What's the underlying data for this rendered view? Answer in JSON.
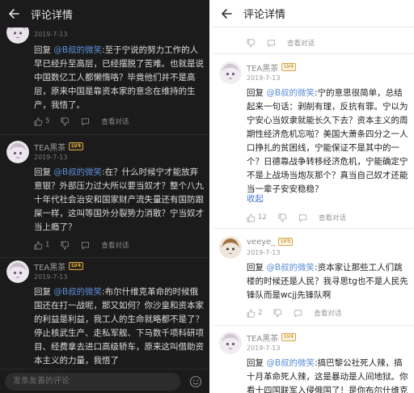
{
  "left": {
    "title": "评论详情",
    "input_placeholder": "发条友善的评论",
    "comments": [
      {
        "username": "",
        "date": "2019-7-13",
        "reply_prefix": "回复 ",
        "mention": "@B叔的微笑",
        "text": ":至于宁说的努力工作的人早已经升至高层，已经摆脱了苦难。也就是说中国数亿工人都懒惰咯？毕竟他们并不是高层，原来中国是靠资本家的意念在维持的生产，我悟了。",
        "likes": "5",
        "view_label": "查看对话"
      },
      {
        "username": "TEA黑茶",
        "level": "LV4",
        "date": "2019-7-13",
        "reply_prefix": "回复 ",
        "mention": "@B叔的微笑",
        "text": ":在？什么时候宁才能放弃意银？外部压力过大所以要当奴才？整个八九十年代社会治安和国家财产流失量还有国防跟屎一样，这叫等国外分裂势力消散？宁当奴才当上瘾了？",
        "likes": "1",
        "view_label": "查看对话"
      },
      {
        "username": "TEA黑茶",
        "level": "LV4",
        "date": "2019-7-13",
        "reply_prefix": "回复 ",
        "mention": "@B叔的微笑",
        "text": ":布尔什维克革命的时候俄国还在打一战呢，那又如何？你沙皇和资本家的利益是利益，我工人的生命就略都不是了？停止核武生产、走私军舰、下马数千项科研项目、经费拿去进口高级轿车，原来这叫借助资本主义的力量，我悟了"
      }
    ]
  },
  "right": {
    "title": "评论详情",
    "top_view_label": "查看对话",
    "comments": [
      {
        "username": "TEA黑茶",
        "level": "LV4",
        "date": "2019-7-13",
        "reply_prefix": "回复 ",
        "mention": "@B叔的微笑",
        "text": ":宁的意思很简单，总结起来一句话：剥削有理，反抗有罪。宁以为宁安心当奴隶就能长久下去？资本主义的周期性经济危机忘啦？美国大萧条四分之一人口挣扎的贫困线，宁能保证不是其中的一个？日德靠战争转移经济危机，宁能确定宁不是上战场当炮灰那个？真当自己奴才还能当一辈子安安稳稳？",
        "collapse": "收起",
        "likes": "12",
        "view_label": "查看对话"
      },
      {
        "username": "veeye_",
        "level": "LV5",
        "date": "2019-7-13",
        "reply_prefix": "回复 ",
        "mention": "@B叔的微笑",
        "text": ":资本家让那些工人们跳楼的时候还是人民？我寻思tg也不是人民先锋队而是wcjj先锋队啊",
        "likes": "2",
        "view_label": "查看对话"
      },
      {
        "username": "TEA黑茶",
        "level": "LV4",
        "date": "2019-7-13",
        "reply_prefix": "回复 ",
        "mention": "@B叔的微笑",
        "text": ":搞巴黎公社死人辣，搞十月革命死人辣，这是暴动是人间地狱。你看十四国联军入侵俄国了！是你布尔什维克"
      }
    ]
  },
  "colors": {
    "accent_link": "#5b8ed6",
    "badge": "#d9a441",
    "dark_bg": "#1b1b1b",
    "light_bg": "#ffffff"
  }
}
